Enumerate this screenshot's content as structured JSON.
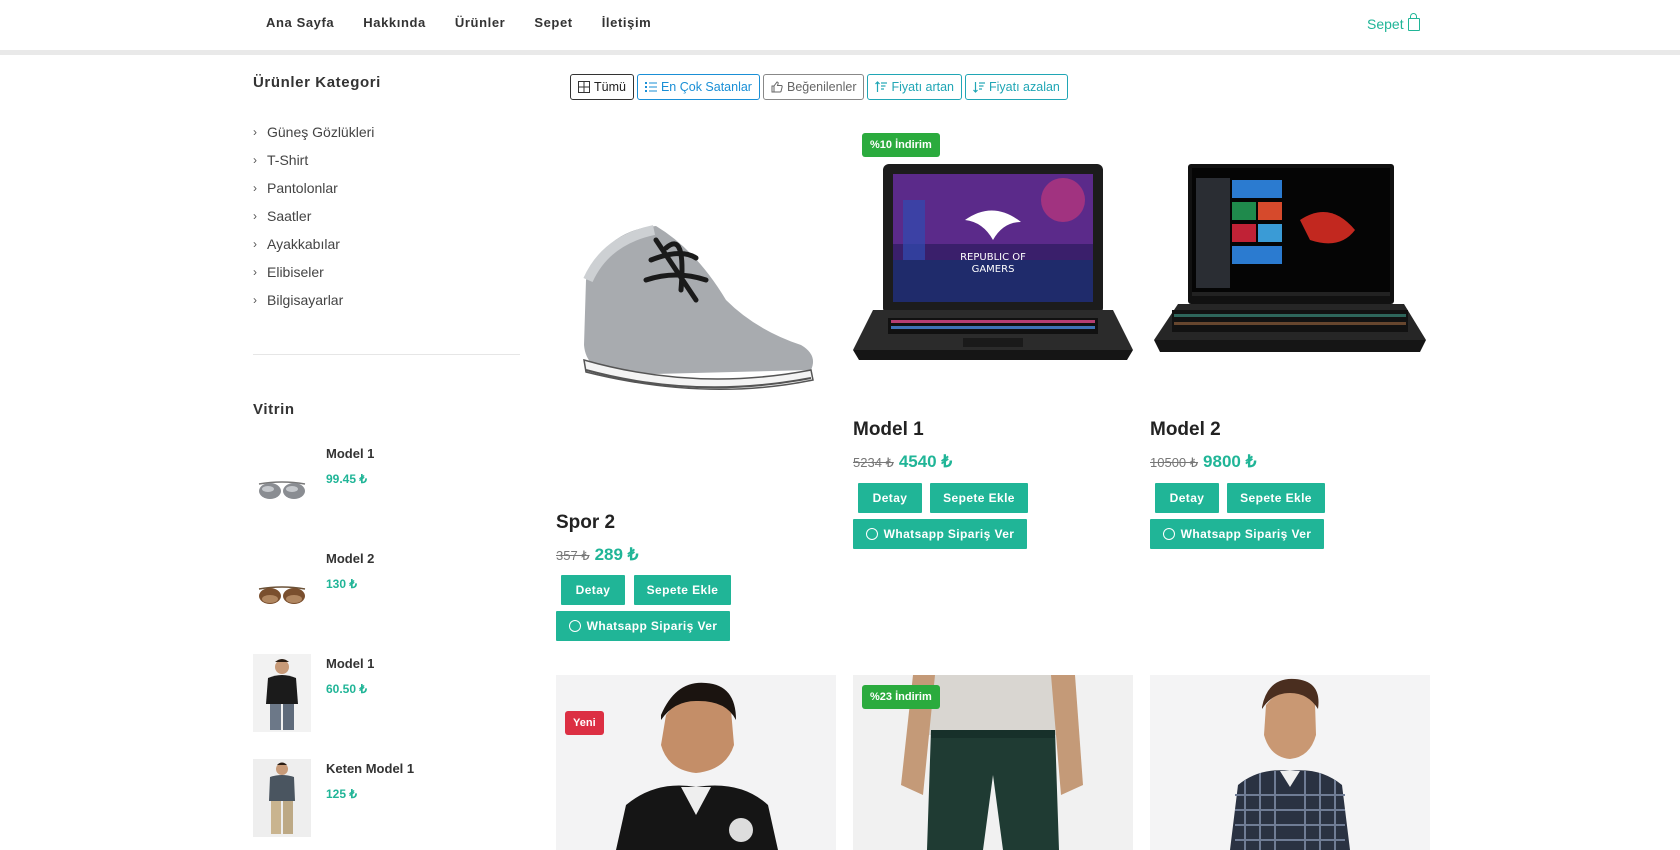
{
  "nav": {
    "links": [
      "Ana Sayfa",
      "Hakkında",
      "Ürünler",
      "Sepet",
      "İletişim"
    ],
    "cart_label": "Sepet"
  },
  "sidebar": {
    "categories_title": "Ürünler Kategori",
    "categories": [
      "Güneş Gözlükleri",
      "T-Shirt",
      "Pantolonlar",
      "Saatler",
      "Ayakkabılar",
      "Elibiseler",
      "Bilgisayarlar"
    ],
    "showcase_title": "Vitrin",
    "showcase": [
      {
        "name": "Model 1",
        "price": "99.45 ₺",
        "image": "sunglasses-gray"
      },
      {
        "name": "Model 2",
        "price": "130 ₺",
        "image": "sunglasses-brown"
      },
      {
        "name": "Model 1",
        "price": "60.50 ₺",
        "image": "man-black-polo"
      },
      {
        "name": "Keten Model 1",
        "price": "125 ₺",
        "image": "man-linen-shirt"
      }
    ]
  },
  "filters": {
    "all": "Tümü",
    "best_sellers": "En Çok Satanlar",
    "liked": "Beğenilenler",
    "price_asc": "Fiyatı artan",
    "price_desc": "Fiyatı azalan"
  },
  "products": [
    {
      "name": "Spor 2",
      "old_price": "357 ₺",
      "price": "289 ₺",
      "badge": "",
      "image": "gray-sneaker"
    },
    {
      "name": "Model 1",
      "old_price": "5234 ₺",
      "price": "4540 ₺",
      "badge": "%10 İndirim",
      "image": "gaming-laptop-rog"
    },
    {
      "name": "Model 2",
      "old_price": "10500 ₺",
      "price": "9800 ₺",
      "badge": "",
      "image": "laptop-hp-omen"
    }
  ],
  "product_buttons": {
    "detail": "Detay",
    "add_to_cart": "Sepete Ekle",
    "whatsapp": "Whatsapp Sipariş Ver"
  },
  "second_row": [
    {
      "badge": "Yeni",
      "badge_color": "#dc2f43",
      "image": "man-black-polo"
    },
    {
      "badge": "%23 İndirim",
      "badge_color": "#2bab3e",
      "image": "man-green-chinos"
    },
    {
      "badge": "",
      "image": "man-checked-shirt"
    }
  ],
  "colors": {
    "accent": "#20b597",
    "info": "#1a8fd6"
  }
}
